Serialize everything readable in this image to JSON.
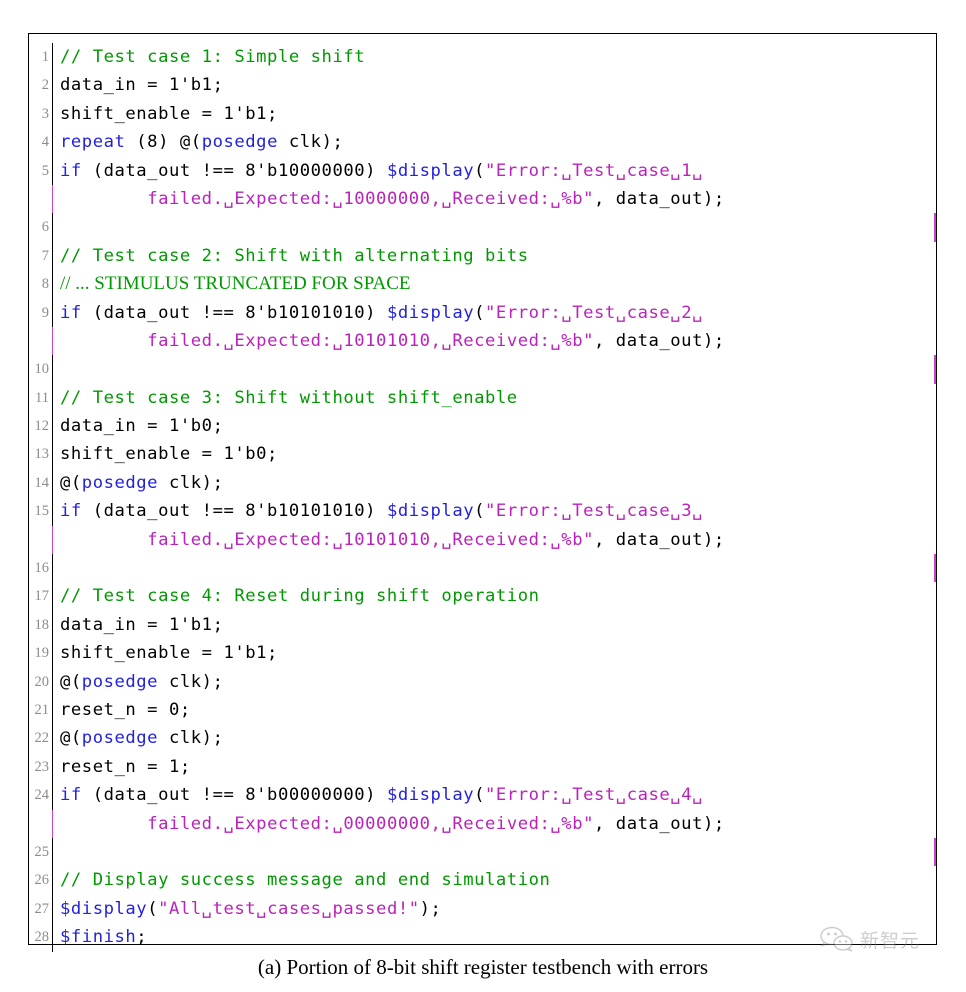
{
  "figure": {
    "caption": "(a) Portion of 8-bit shift register testbench with errors",
    "language": "Verilog",
    "colors": {
      "comment": "#009900",
      "keyword": "#2222dd",
      "string": "#bb22bb",
      "identifier": "#000000",
      "line_number": "#8c8c8c",
      "wrap_marker": "#cc44cc",
      "border": "#000000",
      "background": "#ffffff"
    }
  },
  "watermark": {
    "icon": "wechat-icon",
    "text": "新智元"
  },
  "code": {
    "lines": [
      {
        "n": "1",
        "wrap": false,
        "tokens": [
          {
            "t": "cm",
            "s": "// Test case 1: Simple shift"
          }
        ]
      },
      {
        "n": "2",
        "wrap": false,
        "tokens": [
          {
            "t": "id",
            "s": "data_in = 1'b1;"
          }
        ]
      },
      {
        "n": "3",
        "wrap": false,
        "tokens": [
          {
            "t": "id",
            "s": "shift_enable = 1'b1;"
          }
        ]
      },
      {
        "n": "4",
        "wrap": false,
        "tokens": [
          {
            "t": "kw",
            "s": "repeat"
          },
          {
            "t": "id",
            "s": " (8) @("
          },
          {
            "t": "kw",
            "s": "posedge"
          },
          {
            "t": "id",
            "s": " clk);"
          }
        ]
      },
      {
        "n": "5",
        "wrap": false,
        "tokens": [
          {
            "t": "kw",
            "s": "if"
          },
          {
            "t": "id",
            "s": " (data_out !== 8'b10000000) "
          },
          {
            "t": "kw",
            "s": "$display"
          },
          {
            "t": "id",
            "s": "("
          },
          {
            "t": "str",
            "s": "\"Error:␣Test␣case␣1␣"
          }
        ]
      },
      {
        "n": "",
        "wrap": true,
        "cont": true,
        "tokens": [
          {
            "t": "id",
            "s": "        "
          },
          {
            "t": "str",
            "s": "failed.␣Expected:␣10000000,␣Received:␣%b\""
          },
          {
            "t": "id",
            "s": ", data_out);"
          }
        ]
      },
      {
        "n": "6",
        "wrap": false,
        "tokens": [
          {
            "t": "id",
            "s": ""
          }
        ]
      },
      {
        "n": "7",
        "wrap": false,
        "tokens": [
          {
            "t": "cm",
            "s": "// Test case 2: Shift with alternating bits"
          }
        ]
      },
      {
        "n": "8",
        "wrap": false,
        "serif": true,
        "tokens": [
          {
            "t": "cm-serif",
            "s": "// ... STIMULUS TRUNCATED FOR SPACE"
          }
        ]
      },
      {
        "n": "9",
        "wrap": false,
        "tokens": [
          {
            "t": "kw",
            "s": "if"
          },
          {
            "t": "id",
            "s": " (data_out !== 8'b10101010) "
          },
          {
            "t": "kw",
            "s": "$display"
          },
          {
            "t": "id",
            "s": "("
          },
          {
            "t": "str",
            "s": "\"Error:␣Test␣case␣2␣"
          }
        ]
      },
      {
        "n": "",
        "wrap": true,
        "cont": true,
        "tokens": [
          {
            "t": "id",
            "s": "        "
          },
          {
            "t": "str",
            "s": "failed.␣Expected:␣10101010,␣Received:␣%b\""
          },
          {
            "t": "id",
            "s": ", data_out);"
          }
        ]
      },
      {
        "n": "10",
        "wrap": false,
        "tokens": [
          {
            "t": "id",
            "s": ""
          }
        ]
      },
      {
        "n": "11",
        "wrap": false,
        "tokens": [
          {
            "t": "cm",
            "s": "// Test case 3: Shift without shift_enable"
          }
        ]
      },
      {
        "n": "12",
        "wrap": false,
        "tokens": [
          {
            "t": "id",
            "s": "data_in = 1'b0;"
          }
        ]
      },
      {
        "n": "13",
        "wrap": false,
        "tokens": [
          {
            "t": "id",
            "s": "shift_enable = 1'b0;"
          }
        ]
      },
      {
        "n": "14",
        "wrap": false,
        "tokens": [
          {
            "t": "id",
            "s": "@("
          },
          {
            "t": "kw",
            "s": "posedge"
          },
          {
            "t": "id",
            "s": " clk);"
          }
        ]
      },
      {
        "n": "15",
        "wrap": false,
        "tokens": [
          {
            "t": "kw",
            "s": "if"
          },
          {
            "t": "id",
            "s": " (data_out !== 8'b10101010) "
          },
          {
            "t": "kw",
            "s": "$display"
          },
          {
            "t": "id",
            "s": "("
          },
          {
            "t": "str",
            "s": "\"Error:␣Test␣case␣3␣"
          }
        ]
      },
      {
        "n": "",
        "wrap": true,
        "cont": true,
        "tokens": [
          {
            "t": "id",
            "s": "        "
          },
          {
            "t": "str",
            "s": "failed.␣Expected:␣10101010,␣Received:␣%b\""
          },
          {
            "t": "id",
            "s": ", data_out);"
          }
        ]
      },
      {
        "n": "16",
        "wrap": false,
        "tokens": [
          {
            "t": "id",
            "s": ""
          }
        ]
      },
      {
        "n": "17",
        "wrap": false,
        "tokens": [
          {
            "t": "cm",
            "s": "// Test case 4: Reset during shift operation"
          }
        ]
      },
      {
        "n": "18",
        "wrap": false,
        "tokens": [
          {
            "t": "id",
            "s": "data_in = 1'b1;"
          }
        ]
      },
      {
        "n": "19",
        "wrap": false,
        "tokens": [
          {
            "t": "id",
            "s": "shift_enable = 1'b1;"
          }
        ]
      },
      {
        "n": "20",
        "wrap": false,
        "tokens": [
          {
            "t": "id",
            "s": "@("
          },
          {
            "t": "kw",
            "s": "posedge"
          },
          {
            "t": "id",
            "s": " clk);"
          }
        ]
      },
      {
        "n": "21",
        "wrap": false,
        "tokens": [
          {
            "t": "id",
            "s": "reset_n = 0;"
          }
        ]
      },
      {
        "n": "22",
        "wrap": false,
        "tokens": [
          {
            "t": "id",
            "s": "@("
          },
          {
            "t": "kw",
            "s": "posedge"
          },
          {
            "t": "id",
            "s": " clk);"
          }
        ]
      },
      {
        "n": "23",
        "wrap": false,
        "tokens": [
          {
            "t": "id",
            "s": "reset_n = 1;"
          }
        ]
      },
      {
        "n": "24",
        "wrap": false,
        "tokens": [
          {
            "t": "kw",
            "s": "if"
          },
          {
            "t": "id",
            "s": " (data_out !== 8'b00000000) "
          },
          {
            "t": "kw",
            "s": "$display"
          },
          {
            "t": "id",
            "s": "("
          },
          {
            "t": "str",
            "s": "\"Error:␣Test␣case␣4␣"
          }
        ]
      },
      {
        "n": "",
        "wrap": true,
        "cont": true,
        "tokens": [
          {
            "t": "id",
            "s": "        "
          },
          {
            "t": "str",
            "s": "failed.␣Expected:␣00000000,␣Received:␣%b\""
          },
          {
            "t": "id",
            "s": ", data_out);"
          }
        ]
      },
      {
        "n": "25",
        "wrap": false,
        "tokens": [
          {
            "t": "id",
            "s": ""
          }
        ]
      },
      {
        "n": "26",
        "wrap": false,
        "tokens": [
          {
            "t": "cm",
            "s": "// Display success message and end simulation"
          }
        ]
      },
      {
        "n": "27",
        "wrap": false,
        "tokens": [
          {
            "t": "kw",
            "s": "$display"
          },
          {
            "t": "id",
            "s": "("
          },
          {
            "t": "str",
            "s": "\"All␣test␣cases␣passed!\""
          },
          {
            "t": "id",
            "s": ");"
          }
        ]
      },
      {
        "n": "28",
        "wrap": false,
        "tokens": [
          {
            "t": "kw",
            "s": "$finish"
          },
          {
            "t": "id",
            "s": ";"
          }
        ]
      }
    ]
  }
}
